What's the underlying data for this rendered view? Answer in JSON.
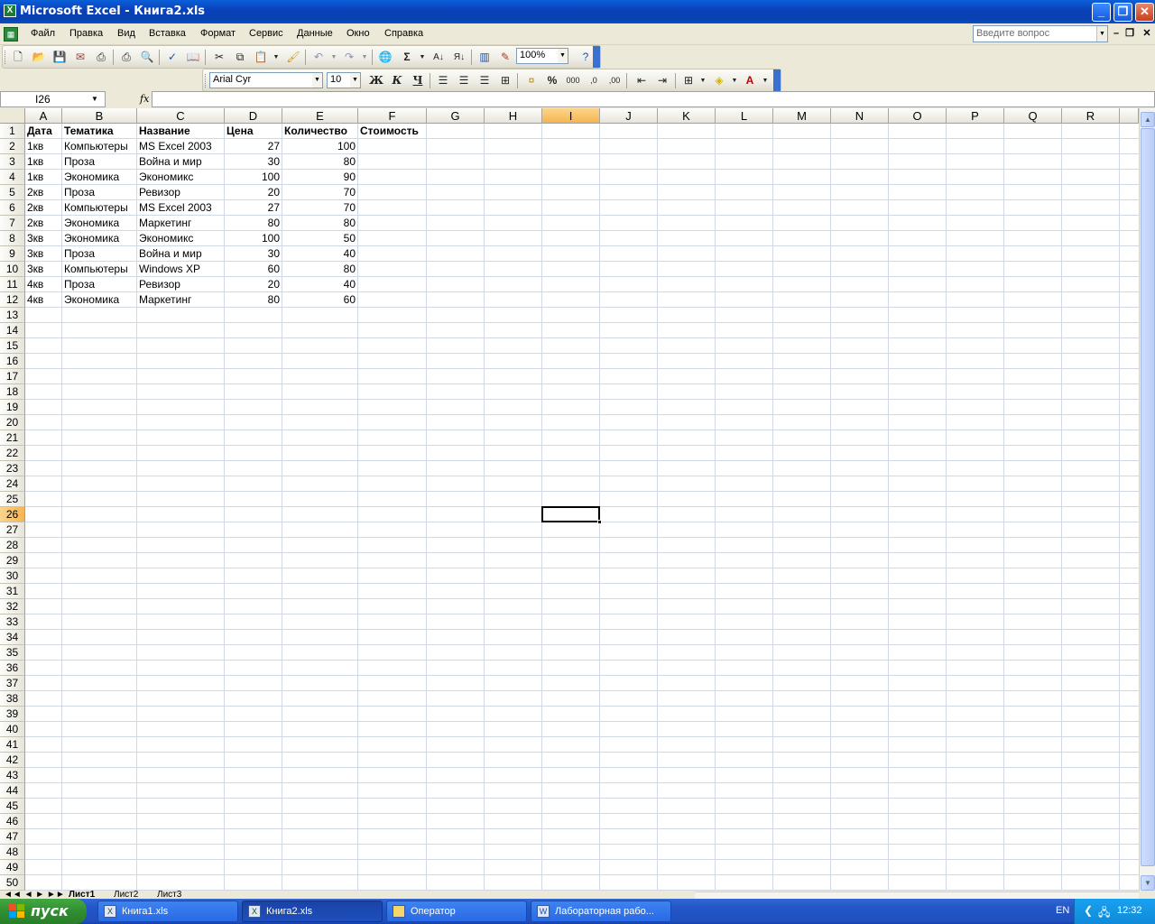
{
  "window": {
    "title": "Microsoft Excel - Книга2.xls",
    "controls": {
      "minimize": "_",
      "restore": "❐",
      "close": "✕"
    }
  },
  "menu": {
    "items": [
      "Файл",
      "Правка",
      "Вид",
      "Вставка",
      "Формат",
      "Сервис",
      "Данные",
      "Окно",
      "Справка"
    ],
    "ask_placeholder": "Введите вопрос"
  },
  "standard_toolbar": {
    "zoom": "100%"
  },
  "formatting_toolbar": {
    "font_name": "Arial Cyr",
    "font_size": "10",
    "bold": "Ж",
    "italic": "К",
    "underline": "Ч"
  },
  "formula_bar": {
    "name_box": "I26",
    "fx": "fx",
    "content": ""
  },
  "sheet": {
    "columns": [
      "A",
      "B",
      "C",
      "D",
      "E",
      "F",
      "G",
      "H",
      "I",
      "J",
      "K",
      "L",
      "M",
      "N",
      "O",
      "P",
      "Q",
      "R"
    ],
    "active_column": "I",
    "active_row": 26,
    "row_count": 50,
    "header_row": [
      "Дата",
      "Тематика",
      "Название",
      "Цена",
      "Количество",
      "Стоимость"
    ],
    "rows": [
      [
        "1кв",
        "Компьютеры",
        "MS Excel 2003",
        "27",
        "100"
      ],
      [
        "1кв",
        "Проза",
        "Война и мир",
        "30",
        "80"
      ],
      [
        "1кв",
        "Экономика",
        "Экономикс",
        "100",
        "90"
      ],
      [
        "2кв",
        "Проза",
        "Ревизор",
        "20",
        "70"
      ],
      [
        "2кв",
        "Компьютеры",
        "MS Excel 2003",
        "27",
        "70"
      ],
      [
        "2кв",
        "Экономика",
        "Маркетинг",
        "80",
        "80"
      ],
      [
        "3кв",
        "Экономика",
        "Экономикс",
        "100",
        "50"
      ],
      [
        "3кв",
        "Проза",
        "Война и мир",
        "30",
        "40"
      ],
      [
        "3кв",
        "Компьютеры",
        "Windows XP",
        "60",
        "80"
      ],
      [
        "4кв",
        "Проза",
        "Ревизор",
        "20",
        "40"
      ],
      [
        "4кв",
        "Экономика",
        "Маркетинг",
        "80",
        "60"
      ]
    ],
    "tabs": [
      "Лист1",
      "Лист2",
      "Лист3"
    ]
  },
  "taskbar": {
    "start": "пуск",
    "buttons": [
      {
        "label": "Книга1.xls",
        "active": false
      },
      {
        "label": "Книга2.xls",
        "active": true
      },
      {
        "label": "Оператор",
        "active": false
      },
      {
        "label": "Лабораторная рабо...",
        "active": false
      }
    ],
    "language": "EN",
    "clock": "12:32"
  },
  "colors": {
    "title_bar": "#0a3fb8",
    "active_header": "#f6b44f",
    "gridline": "#d0d7e5",
    "taskbar": "#2557c8",
    "start_button": "#308e30"
  }
}
